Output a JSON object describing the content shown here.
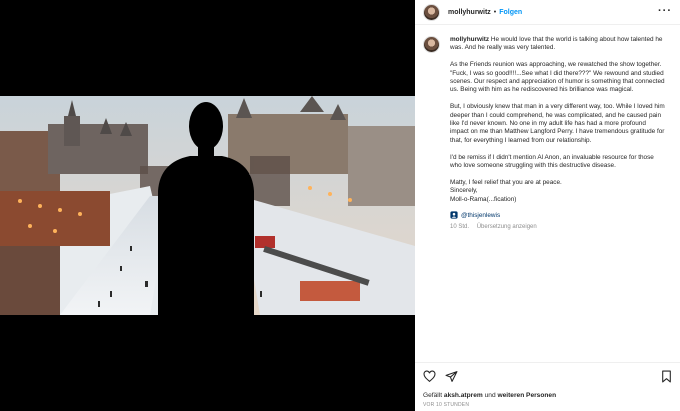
{
  "header": {
    "username": "mollyhurwitz",
    "separator": "•",
    "follow_label": "Folgen",
    "more_icon": "more-horizontal-icon"
  },
  "caption": {
    "username": "mollyhurwitz",
    "paragraphs": [
      "He would love that the world is talking about how talented he was. And he really was very talented.",
      "As the Friends reunion was approaching, we rewatched the show together. \"Fuck, I was so good!!!!...See what I did there???\" We rewound and studied scenes. Our respect and appreciation of humor is something that connected us. Being with him as he rediscovered his brilliance was magical.",
      "But, I obviously knew that man in a very different way, too. While I loved him deeper than I could comprehend, he was complicated, and he caused pain like I'd never known. No one in my adult life has had a more profound impact on me than Matthew Langford Perry. I have tremendous gratitude for that, for everything I learned from our relationship.",
      "I'd be remiss if I didn't mention Al Anon, an invaluable resource for those who love someone struggling with this destructive disease.",
      "Matty, I feel relief that you are at peace.",
      "Sincerely,",
      "Moll-o-Rama(...fication)"
    ],
    "mention": "@thisjenlewis",
    "age": "10 Std.",
    "translate_label": "Übersetzung anzeigen"
  },
  "actions": {
    "like_icon": "heart-icon",
    "share_icon": "send-icon",
    "save_icon": "bookmark-icon"
  },
  "likes": {
    "prefix": "Gefällt",
    "user": "aksh.atprem",
    "middle": "und",
    "others": "weiteren Personen"
  },
  "timestamp": "VOR 10 STUNDEN"
}
